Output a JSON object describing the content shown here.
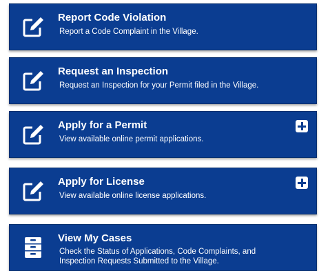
{
  "colors": {
    "card_background": "#0b3d91",
    "text": "#ffffff",
    "plus_button": "#ffffff"
  },
  "cards": [
    {
      "title": "Report Code Violation",
      "description": "Report a Code Complaint in the Village.",
      "icon": "edit-icon"
    },
    {
      "title": "Request an Inspection",
      "description": "Request an Inspection for your Permit filed in the Village.",
      "icon": "edit-icon"
    },
    {
      "title": "Apply for a Permit",
      "description": "View available online permit applications.",
      "icon": "edit-icon",
      "expand_icon": "plus-icon"
    },
    {
      "title": "Apply for License",
      "description": "View available online license applications.",
      "icon": "edit-icon",
      "expand_icon": "plus-icon"
    },
    {
      "title": "View My Cases",
      "description_lines": [
        "Check the Status of Applications, Code Complaints, and",
        "Inspection Requests Submitted to the Village."
      ],
      "icon": "file-cabinet-icon"
    }
  ]
}
